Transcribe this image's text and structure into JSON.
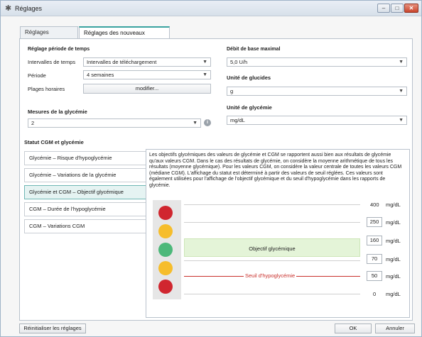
{
  "window": {
    "title": "Réglages",
    "buttons": {
      "minimize": "–",
      "maximize": "□",
      "close": "✕"
    }
  },
  "tabs": [
    {
      "label": "Réglages généraux",
      "active": false
    },
    {
      "label": "Réglages des nouveaux patients",
      "active": true
    }
  ],
  "left_settings": {
    "section_title": "Réglage période de temps",
    "intervalles_label": "Intervalles de temps",
    "intervalles_value": "Intervalles de téléchargement",
    "periode_label": "Période",
    "periode_value": "4 semaines",
    "plages_label": "Plages horaires",
    "plages_button": "modifier...",
    "mesures_title": "Mesures de la glycémie",
    "mesures_value": "2"
  },
  "right_settings": {
    "debit_title": "Débit de base maximal",
    "debit_value": "5,0 U/h",
    "glucides_title": "Unité de glucides",
    "glucides_value": "g",
    "glycemie_title": "Unité de glycémie",
    "glycemie_value": "mg/dL"
  },
  "statut": {
    "title": "Statut CGM et glycémie",
    "items": [
      {
        "label": "Glycémie – Risque d'hypoglycémie",
        "active": false
      },
      {
        "label": "Glycémie – Variations de la glycémie",
        "active": false
      },
      {
        "label": "Glycémie et CGM – Objectif glycémique",
        "active": true
      },
      {
        "label": "CGM – Durée de l'hypoglycémie",
        "active": false
      },
      {
        "label": "CGM – Variations CGM",
        "active": false
      }
    ]
  },
  "detail": {
    "description": "Les objectifs glycémiques des valeurs de glycémie et CGM se rapportent aussi bien aux résultats de glycémie qu'aux valeurs CGM. Dans le cas des résultats de glycémie, on considère la moyenne arithmétique de tous les résultats (moyenne glycémique). Pour les valeurs CGM, on considère la valeur centrale de toutes les valeurs CGM (médiane CGM). L'affichage du statut est déterminé à partir des valeurs de seuil réglées. Ces valeurs sont également utilisées pour l'affichage de l'objectif glycémique et du seuil d'hypoglycémie dans les rapports de glycémie.",
    "target_label": "Objectif glycémique",
    "seuil_label": "Seuil d'hypoglycémie",
    "unit": "mg/dL",
    "thresholds": [
      {
        "value": "400",
        "editable": false
      },
      {
        "value": "250",
        "editable": true
      },
      {
        "value": "160",
        "editable": true
      },
      {
        "value": "70",
        "editable": true
      },
      {
        "value": "50",
        "editable": true
      },
      {
        "value": "0",
        "editable": false
      }
    ],
    "lights": [
      "#d0262f",
      "#f6bd2b",
      "#4cb87a",
      "#f6bd2b",
      "#d0262f"
    ]
  },
  "footer": {
    "reset": "Réinitialiser les réglages",
    "ok": "OK",
    "cancel": "Annuler"
  }
}
